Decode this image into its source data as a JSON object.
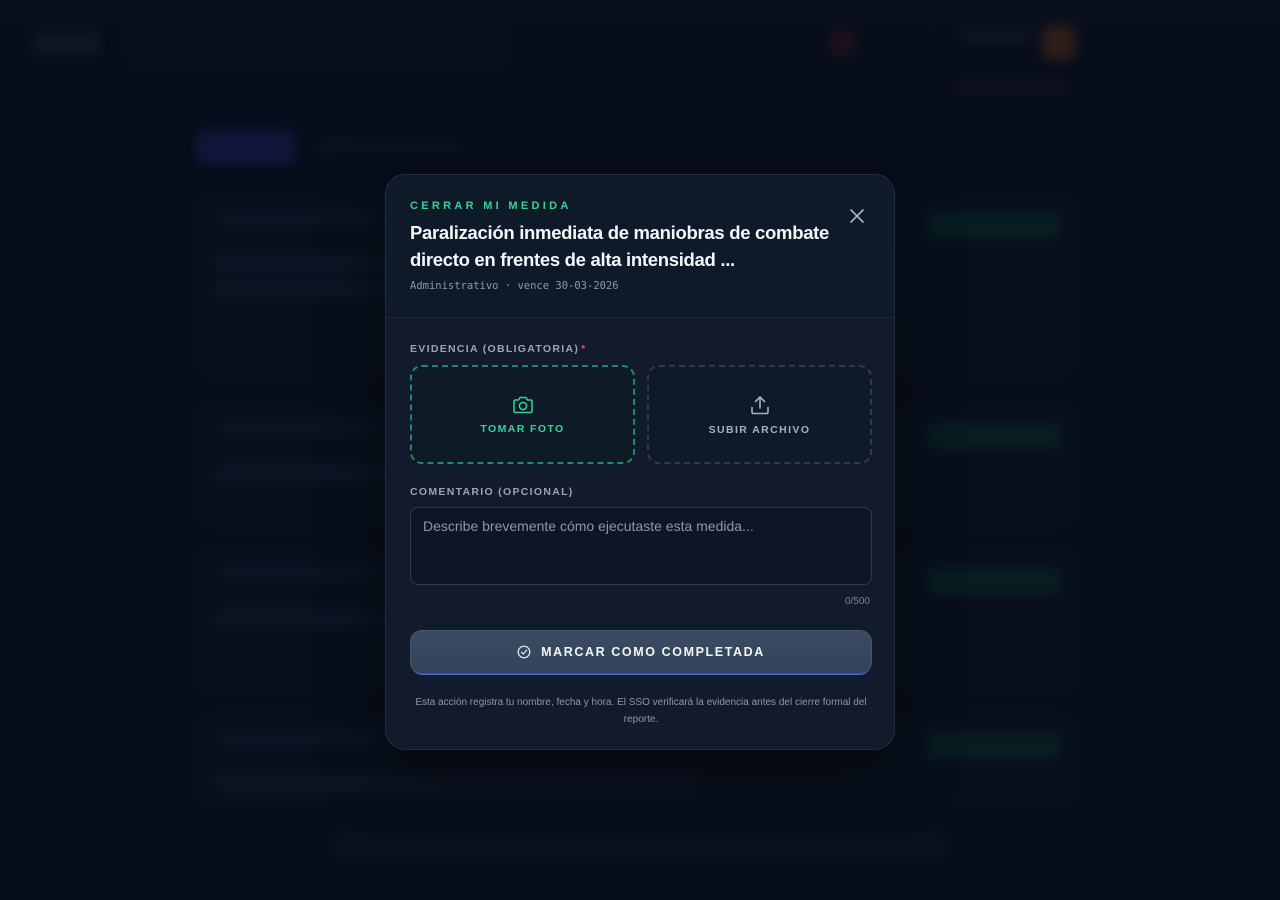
{
  "modal": {
    "eyebrow": "CERRAR MI MEDIDA",
    "title": "Paralización inmediata de maniobras de combate directo en frentes de alta intensidad ...",
    "meta": "Administrativo · vence 30-03-2026",
    "close_icon": "close-icon"
  },
  "evidence": {
    "label": "EVIDENCIA (OBLIGATORIA)",
    "required_mark": "*",
    "take_photo": {
      "label": "TOMAR FOTO",
      "icon": "camera-icon"
    },
    "upload_file": {
      "label": "SUBIR ARCHIVO",
      "icon": "upload-icon"
    }
  },
  "comment": {
    "label": "COMENTARIO (OPCIONAL)",
    "placeholder": "Describe brevemente cómo ejecutaste esta medida...",
    "value": "",
    "counter": "0/500"
  },
  "submit": {
    "label": "MARCAR COMO COMPLETADA",
    "icon": "check-circle-icon"
  },
  "footer_note": "Esta acción registra tu nombre, fecha y hora. El SSO verificará la evidencia antes del cierre formal del reporte.",
  "colors": {
    "accent": "#34d39a",
    "required": "#e84a6a",
    "modal_bg": "#111b2b",
    "page_bg": "#0a1120"
  }
}
